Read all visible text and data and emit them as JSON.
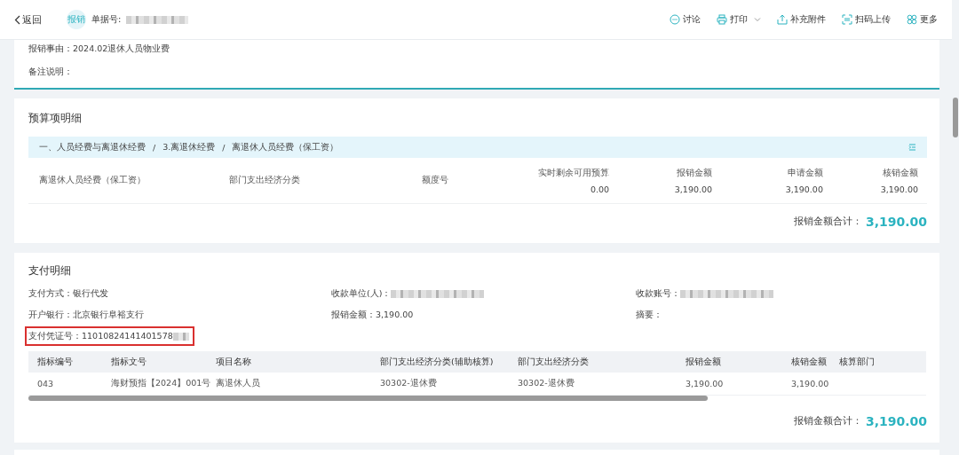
{
  "header": {
    "back": "返回",
    "badge": "报销",
    "doc_no_label": "单据号:",
    "doc_no_redacted": true,
    "actions": [
      {
        "label": "讨论",
        "dropdown": false
      },
      {
        "label": "打印",
        "dropdown": true
      },
      {
        "label": "补充附件",
        "dropdown": false
      },
      {
        "label": "扫码上传",
        "dropdown": false
      },
      {
        "label": "更多",
        "dropdown": false
      }
    ]
  },
  "summary": {
    "fields": [
      {
        "label": "报销事由：",
        "value": "2024.02退休人员物业费"
      },
      {
        "label": "备注说明："
      }
    ]
  },
  "budget": {
    "title": "预算项明细",
    "breadcrumb_separator": "/",
    "breadcrumb": [
      "一、人员经费与离退休经费",
      "3.离退休经费",
      "离退休人员经费（保工资）"
    ],
    "row": {
      "name": "离退休人员经费（保工资）",
      "columns": [
        {
          "label": "部门支出经济分类"
        },
        {
          "label": "额度号"
        },
        {
          "label": "实时剩余可用预算",
          "value": "0.00"
        },
        {
          "label": "报销金额",
          "value": "3,190.00"
        },
        {
          "label": "申请金额",
          "value": "3,190.00"
        },
        {
          "label": "核销金额",
          "value": "3,190.00"
        }
      ]
    },
    "total_label": "报销金额合计：",
    "total": "3,190.00"
  },
  "payment": {
    "title": "支付明细",
    "fields": [
      {
        "label": "支付方式：",
        "value": "银行代发",
        "redacted": false,
        "highlighted": false
      },
      {
        "label": "收款单位(人)：",
        "redacted": true,
        "highlighted": false
      },
      {
        "label": "收款账号：",
        "redacted": true,
        "highlighted": false
      },
      {
        "label": "开户银行：",
        "value": "北京银行阜裕支行",
        "redacted": false,
        "highlighted": false
      },
      {
        "label": "报销金额：",
        "value": "3,190.00",
        "redacted": false,
        "highlighted": false
      },
      {
        "label": "摘要：",
        "redacted": false,
        "highlighted": false
      },
      {
        "label": "支付凭证号：",
        "value": "11010824141401578",
        "redacted": true,
        "highlighted": true
      }
    ],
    "table": {
      "columns": [
        "指标编号",
        "指标文号",
        "项目名称",
        "部门支出经济分类(辅助核算)",
        "部门支出经济分类",
        "报销金额",
        "核销金额",
        "核算部门"
      ],
      "rows": [
        [
          "043",
          "海财预指【2024】001号",
          "离退休人员",
          "30302-退休费",
          "30302-退休费",
          "3,190.00",
          "3,190.00",
          ""
        ]
      ]
    },
    "total_label": "报销金额合计：",
    "total": "3,190.00"
  }
}
